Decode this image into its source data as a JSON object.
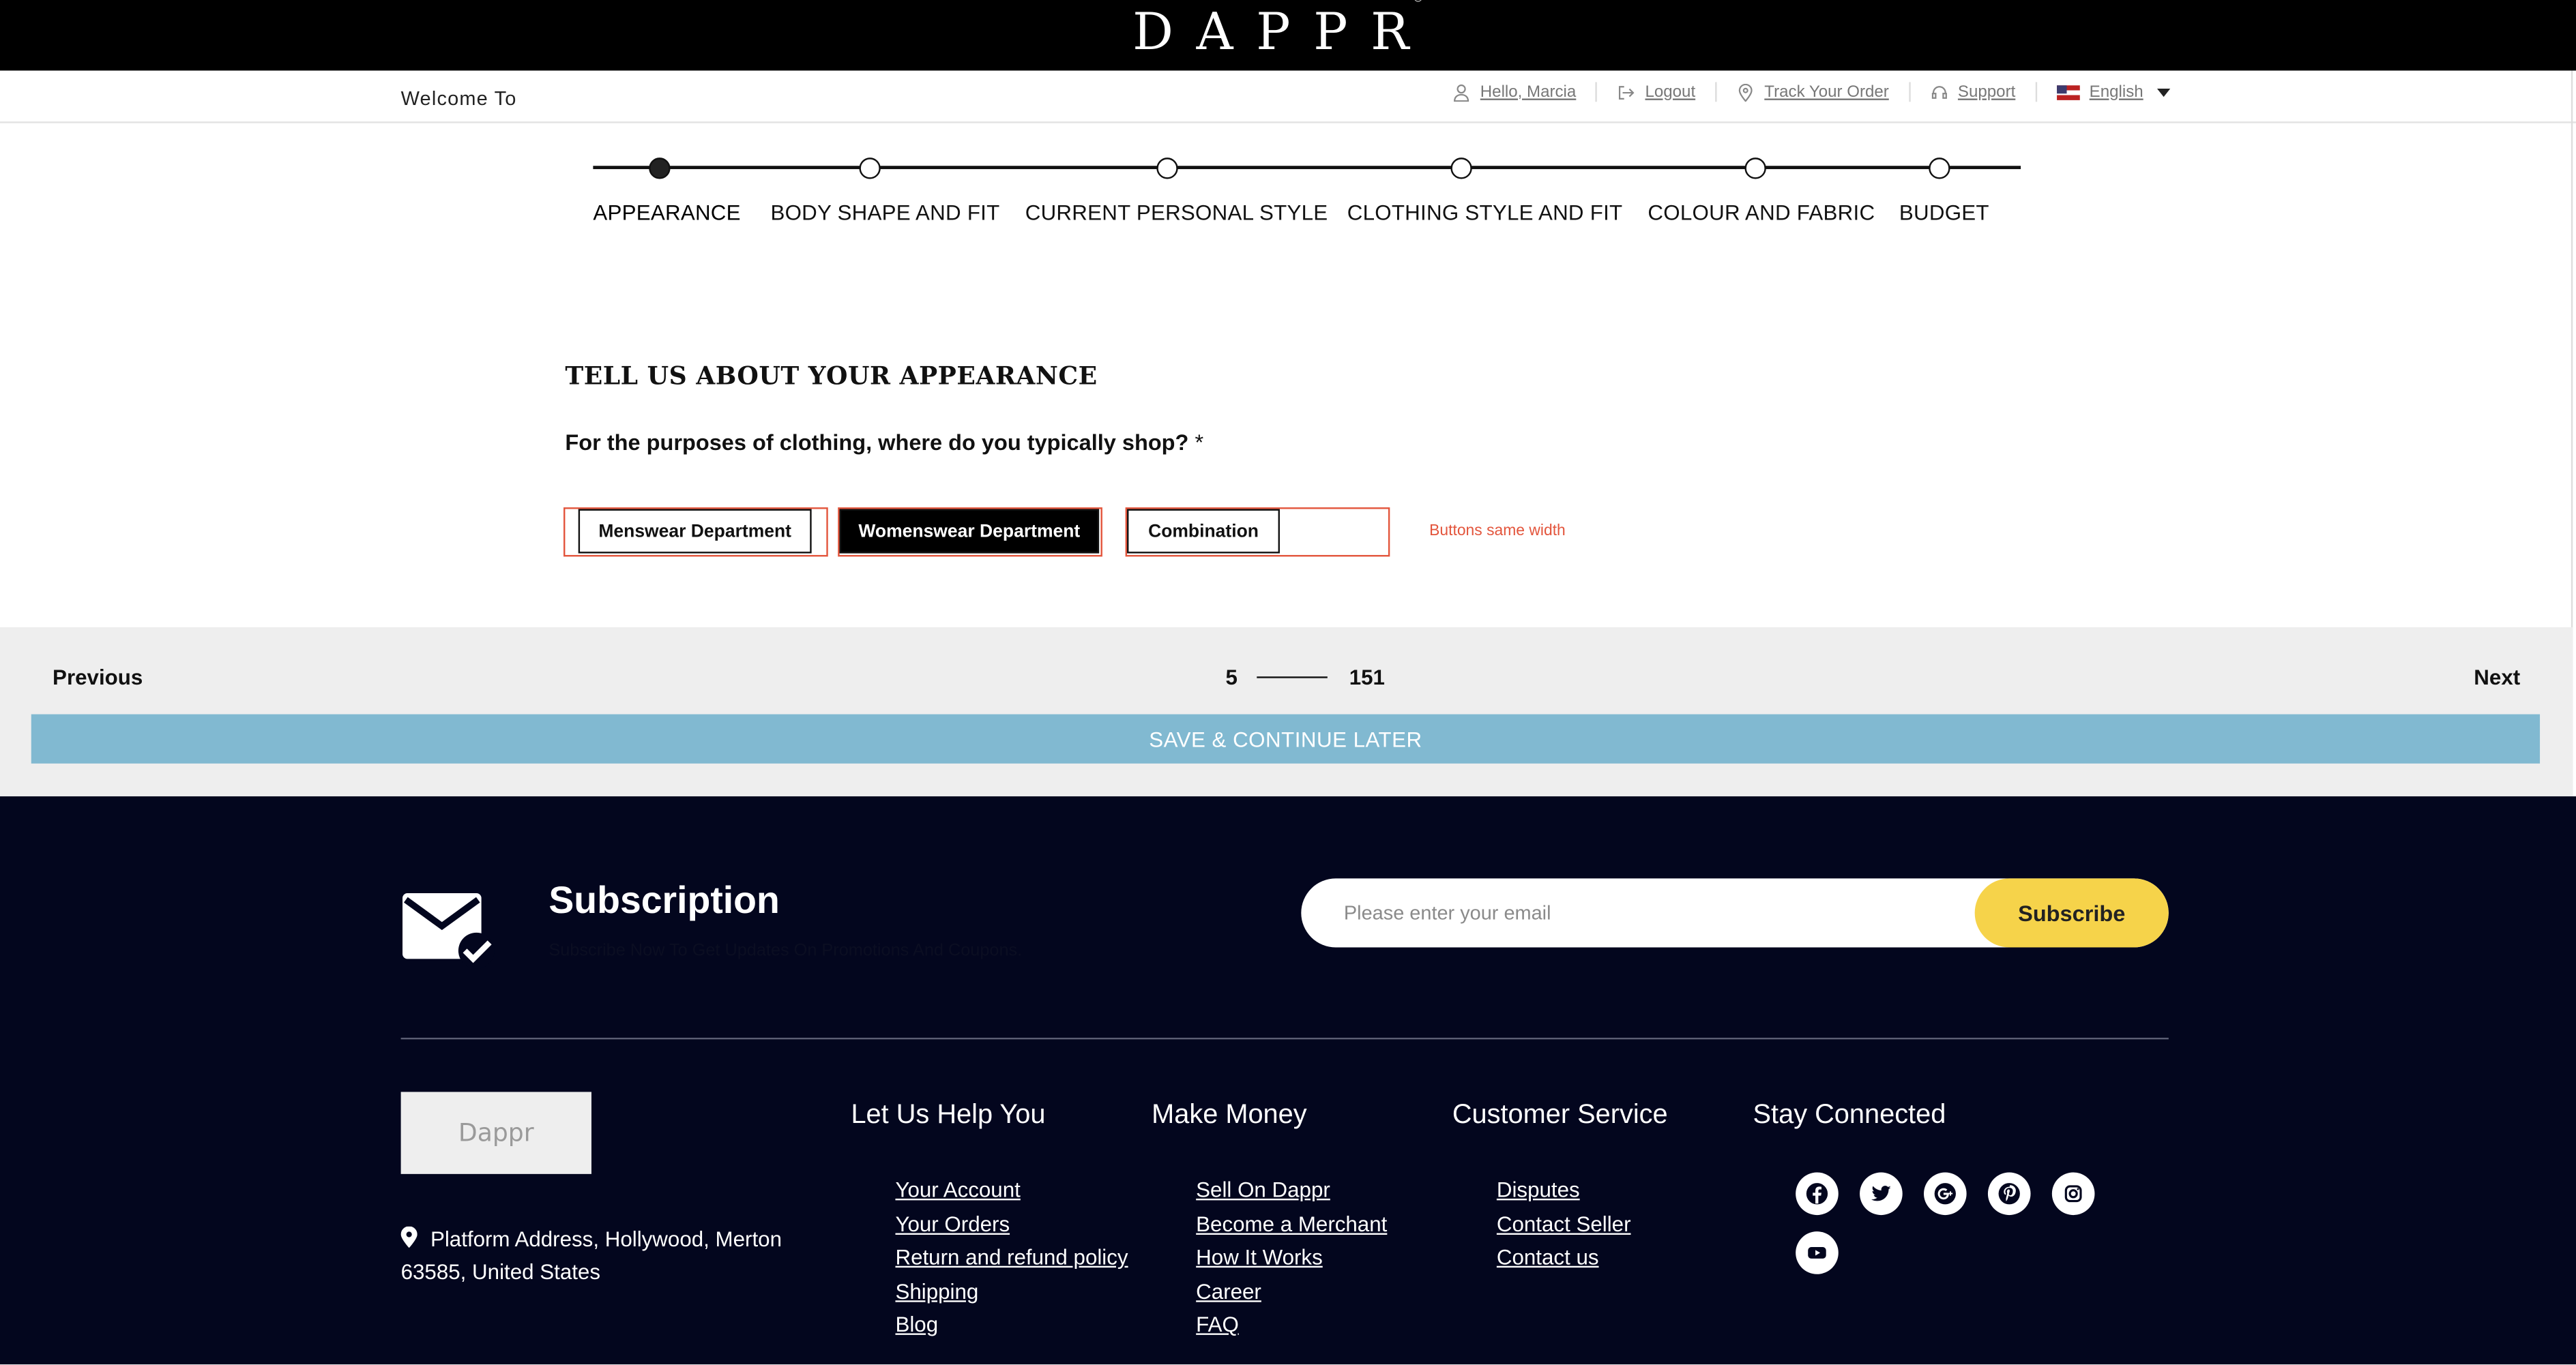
{
  "brand": {
    "name": "DAPPR",
    "mark": "®"
  },
  "header": {
    "welcome": "Welcome To",
    "greeting": "Hello, Marcia",
    "logout": "Logout",
    "track": "Track Your Order",
    "support": "Support",
    "language": "English"
  },
  "stepper": {
    "steps": [
      {
        "label": "APPEARANCE",
        "active": true
      },
      {
        "label": "BODY SHAPE AND FIT",
        "active": false
      },
      {
        "label": "CURRENT PERSONAL STYLE",
        "active": false
      },
      {
        "label": "CLOTHING STYLE AND FIT",
        "active": false
      },
      {
        "label": "COLOUR AND FABRIC",
        "active": false
      },
      {
        "label": "BUDGET",
        "active": false
      }
    ]
  },
  "question": {
    "title": "TELL US ABOUT YOUR APPEARANCE",
    "text": "For the purposes of clothing, where do you typically shop?",
    "required_mark": "*",
    "options": [
      {
        "label": "Menswear Department",
        "selected": false
      },
      {
        "label": "Womenswear Department",
        "selected": true
      },
      {
        "label": "Combination",
        "selected": false
      }
    ],
    "note": "Buttons same width"
  },
  "pager": {
    "previous": "Previous",
    "next": "Next",
    "current": "5",
    "total": "151",
    "save": "SAVE & CONTINUE LATER"
  },
  "footer": {
    "subscription_title": "Subscription",
    "subscription_desc": "Subscribe Now To Get Updates On Promotions And Coupons.",
    "email_placeholder": "Please enter your email",
    "subscribe_label": "Subscribe",
    "logo_text": "Dappr",
    "address": "Platform Address, Hollywood, Merton 63585, United States",
    "columns": [
      {
        "title": "Let Us Help You",
        "links": [
          "Your Account",
          "Your Orders",
          "Return and refund policy",
          "Shipping",
          "Blog"
        ]
      },
      {
        "title": "Make Money",
        "links": [
          "Sell On Dappr",
          "Become a Merchant",
          "How It Works",
          "Career",
          "FAQ"
        ]
      },
      {
        "title": "Customer Service",
        "links": [
          "Disputes",
          "Contact Seller",
          "Contact us"
        ]
      },
      {
        "title": "Stay Connected",
        "links": []
      }
    ],
    "social_icons": [
      "facebook-icon",
      "twitter-icon",
      "google-plus-icon",
      "pinterest-icon",
      "instagram-icon",
      "youtube-icon"
    ]
  },
  "colors": {
    "accent_red": "#e3553c",
    "save_bar": "#81b9d1",
    "footer_bg": "#03061e",
    "subscribe_yellow": "#f6d34a"
  }
}
